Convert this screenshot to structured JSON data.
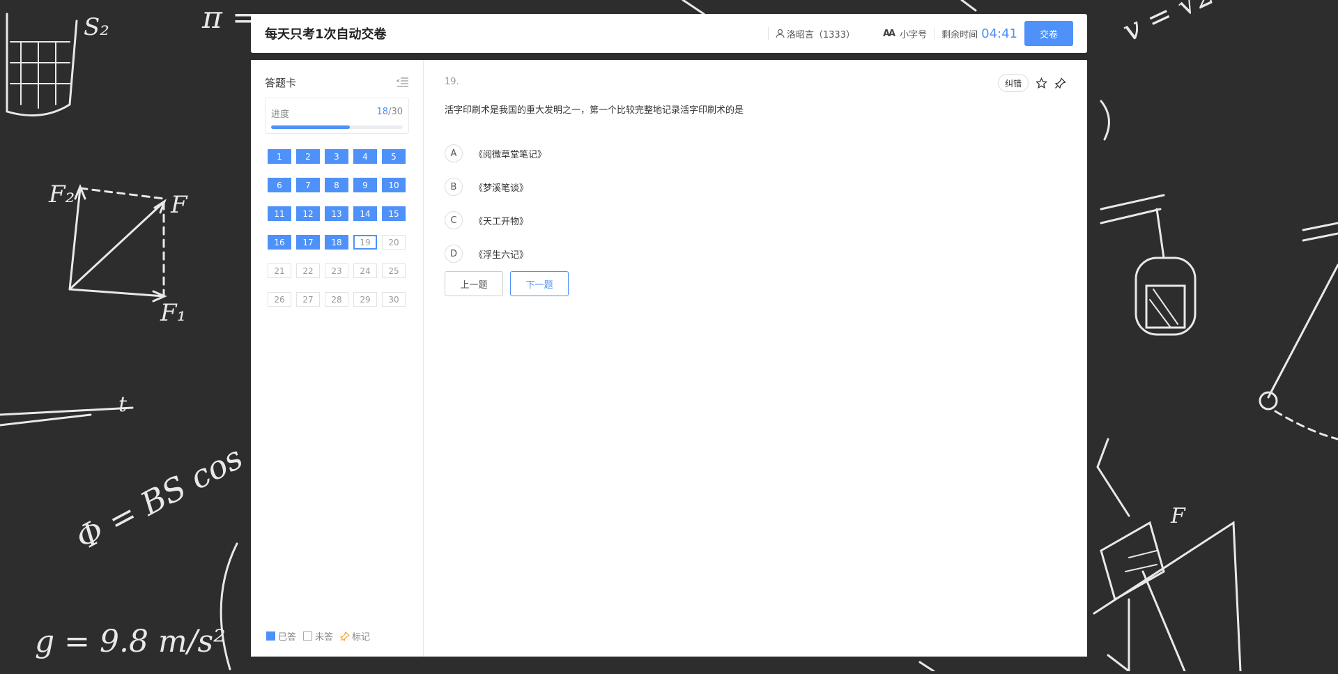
{
  "header": {
    "title": "每天只考1次自动交卷",
    "user": "洛昭言（1333）",
    "font_toggle_label": "小字号",
    "timer_label": "剩余时间",
    "timer_value": "04:41",
    "submit_label": "交卷"
  },
  "sidebar": {
    "title": "答题卡",
    "progress_label": "进度",
    "answered": "18",
    "total": "/30",
    "progress_fraction": 0.6,
    "questions": [
      {
        "n": "1",
        "state": "done"
      },
      {
        "n": "2",
        "state": "done"
      },
      {
        "n": "3",
        "state": "done"
      },
      {
        "n": "4",
        "state": "done"
      },
      {
        "n": "5",
        "state": "done"
      },
      {
        "n": "6",
        "state": "done"
      },
      {
        "n": "7",
        "state": "done"
      },
      {
        "n": "8",
        "state": "done"
      },
      {
        "n": "9",
        "state": "done"
      },
      {
        "n": "10",
        "state": "done"
      },
      {
        "n": "11",
        "state": "done"
      },
      {
        "n": "12",
        "state": "done"
      },
      {
        "n": "13",
        "state": "done"
      },
      {
        "n": "14",
        "state": "done"
      },
      {
        "n": "15",
        "state": "done"
      },
      {
        "n": "16",
        "state": "done"
      },
      {
        "n": "17",
        "state": "done"
      },
      {
        "n": "18",
        "state": "done"
      },
      {
        "n": "19",
        "state": "current"
      },
      {
        "n": "20",
        "state": "todo"
      },
      {
        "n": "21",
        "state": "todo"
      },
      {
        "n": "22",
        "state": "todo"
      },
      {
        "n": "23",
        "state": "todo"
      },
      {
        "n": "24",
        "state": "todo"
      },
      {
        "n": "25",
        "state": "todo"
      },
      {
        "n": "26",
        "state": "todo"
      },
      {
        "n": "27",
        "state": "todo"
      },
      {
        "n": "28",
        "state": "todo"
      },
      {
        "n": "29",
        "state": "todo"
      },
      {
        "n": "30",
        "state": "todo"
      }
    ],
    "legend": {
      "answered": "已答",
      "unanswered": "未答",
      "marked": "标记"
    }
  },
  "question": {
    "number": "19.",
    "report_label": "纠错",
    "text": "活字印刷术是我国的重大发明之一，第一个比较完整地记录活字印刷术的是",
    "options": [
      {
        "letter": "A",
        "text": "《阅微草堂笔记》"
      },
      {
        "letter": "B",
        "text": "《梦溪笔谈》"
      },
      {
        "letter": "C",
        "text": "《天工开物》"
      },
      {
        "letter": "D",
        "text": "《浮生六记》"
      }
    ],
    "prev_label": "上一题",
    "next_label": "下一题"
  },
  "colors": {
    "accent": "#4e91f8",
    "background": "#2d2d2e"
  }
}
